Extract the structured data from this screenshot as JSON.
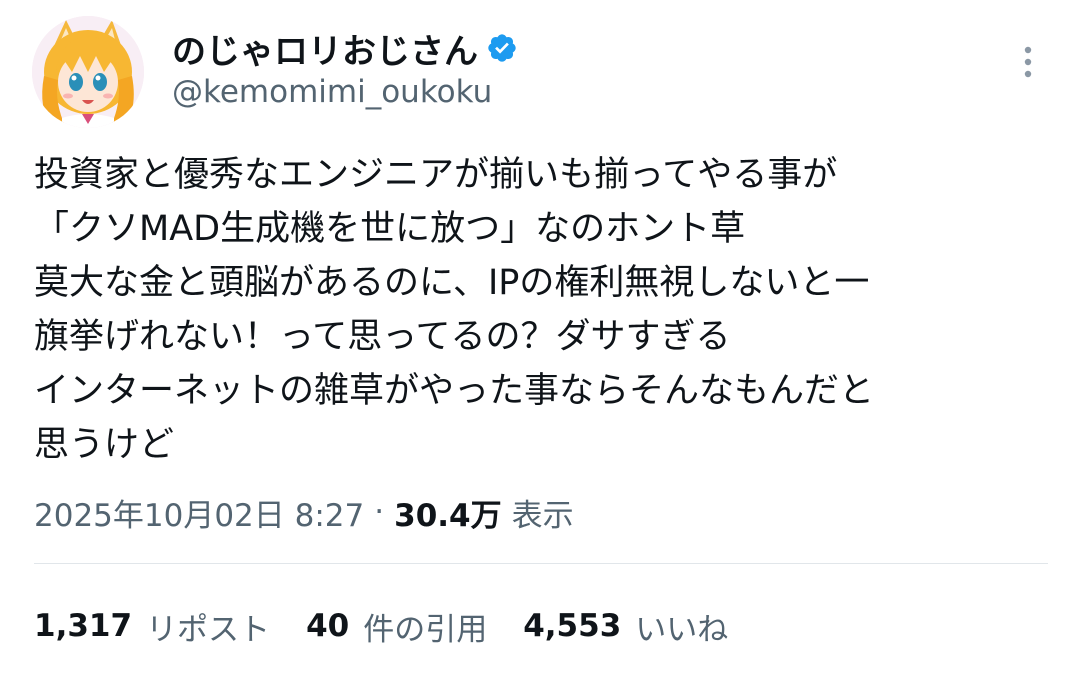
{
  "author": {
    "display_name": "のじゃロリおじさん",
    "handle": "@kemomimi_oukoku",
    "verified": true,
    "badge_color": "#1d9bf0"
  },
  "tweet": {
    "lines": [
      "投資家と優秀なエンジニアが揃いも揃ってやる事が",
      "「クソMAD生成機を世に放つ」なのホント草",
      "莫大な金と頭脳があるのに、IPの権利無視しないと一",
      "旗挙げれない！って思ってるの？ダサすぎる",
      "インターネットの雑草がやった事ならそんなもんだと",
      "思うけど"
    ]
  },
  "meta": {
    "timestamp": "2025年10月02日 8:27",
    "separator": "·",
    "views_count": "30.4万",
    "views_label": "表示"
  },
  "stats": {
    "reposts_count": "1,317",
    "reposts_label": "リポスト",
    "quotes_count": "40",
    "quotes_label": "件の引用",
    "likes_count": "4,553",
    "likes_label": "いいね"
  },
  "icons": {
    "more": "more-vertical-icon",
    "verified": "verified-badge-icon",
    "avatar": "anime-girl-avatar"
  }
}
